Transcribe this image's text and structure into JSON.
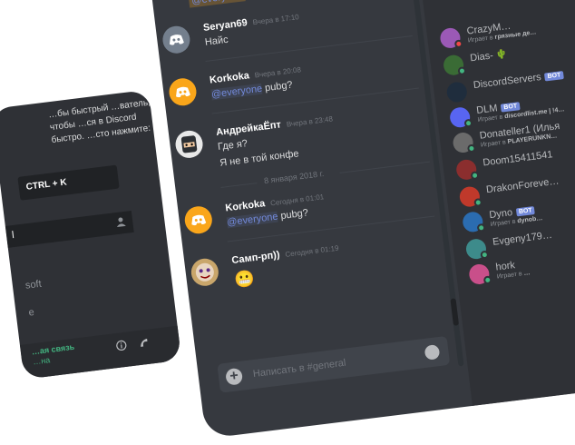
{
  "left_panel": {
    "hint": "…бы быстрый …ватель, чтобы …ся в Discord быстро. …сто нажмите:",
    "hotkey": "CTRL + K",
    "channel_partial": "l",
    "item_sft": "soft",
    "item_fe": "e",
    "voice_status": "…ая связь",
    "voice_sub": "…на"
  },
  "chat": {
    "channel": "general",
    "top_mention": "@everyone",
    "messages": [
      {
        "author": "Seryan69",
        "time": "Вчера в 17:10",
        "lines": [
          "Найс"
        ]
      },
      {
        "author": "Korkoka",
        "time": "Вчера в 20:08",
        "mention": "@everyone",
        "text": "pubg?"
      },
      {
        "author": "АндрейкаЁпт",
        "time": "Вчера в 23:48",
        "lines": [
          "Где я?",
          "Я не в той конфе"
        ]
      },
      {
        "author": "Korkoka",
        "time": "Сегодня в 01:01",
        "mention": "@everyone",
        "text": "pubg?"
      },
      {
        "author": "Самп-рп))",
        "time": "Сегодня в 01:19",
        "emoji": "😬"
      }
    ],
    "date_divider": "8 января 2018 г.",
    "input_placeholder": "Написать в #general"
  },
  "members": [
    {
      "name": "CrazyM…",
      "activity_prefix": "Играет в",
      "activity": "грязные де…",
      "status_color": "#f04747",
      "avatar_color": "#9b59b6"
    },
    {
      "name": "Dias-",
      "suffix": "🌵",
      "status_color": "#43b581",
      "avatar_color": "#3a6b35"
    },
    {
      "name": "DiscordServers",
      "bot": "BOT",
      "status_color": "#43b581",
      "avatar_color": "#1f2d3d"
    },
    {
      "name": "DLM",
      "bot": "BOT",
      "activity_prefix": "Играет в",
      "activity": "discordlist.me | !4…",
      "status_color": "#43b581",
      "avatar_color": "#5865f2"
    },
    {
      "name": "Donateller1 (Илья",
      "activity_prefix": "Играет в",
      "activity": "PLAYERUNKN…",
      "status_color": "#43b581",
      "avatar_color": "#6b6b6b"
    },
    {
      "name": "Doom15411541",
      "status_color": "#43b581",
      "avatar_color": "#8b2e2e"
    },
    {
      "name": "DrakonForeve…",
      "status_color": "#43b581",
      "avatar_color": "#c0392b"
    },
    {
      "name": "Dyno",
      "bot": "BOT",
      "activity_prefix": "Играет в",
      "activity": "dynob…",
      "status_color": "#43b581",
      "avatar_color": "#2b6cb0"
    },
    {
      "name": "Evgeny179…",
      "status_color": "#43b581",
      "avatar_color": "#3d8b8b"
    },
    {
      "name": "hork",
      "activity_prefix": "Играет в",
      "activity": "…",
      "status_color": "#43b581",
      "avatar_color": "#c94f8a"
    }
  ],
  "colors": {
    "accent": "#7289da",
    "online": "#43b581",
    "dnd": "#f04747"
  }
}
